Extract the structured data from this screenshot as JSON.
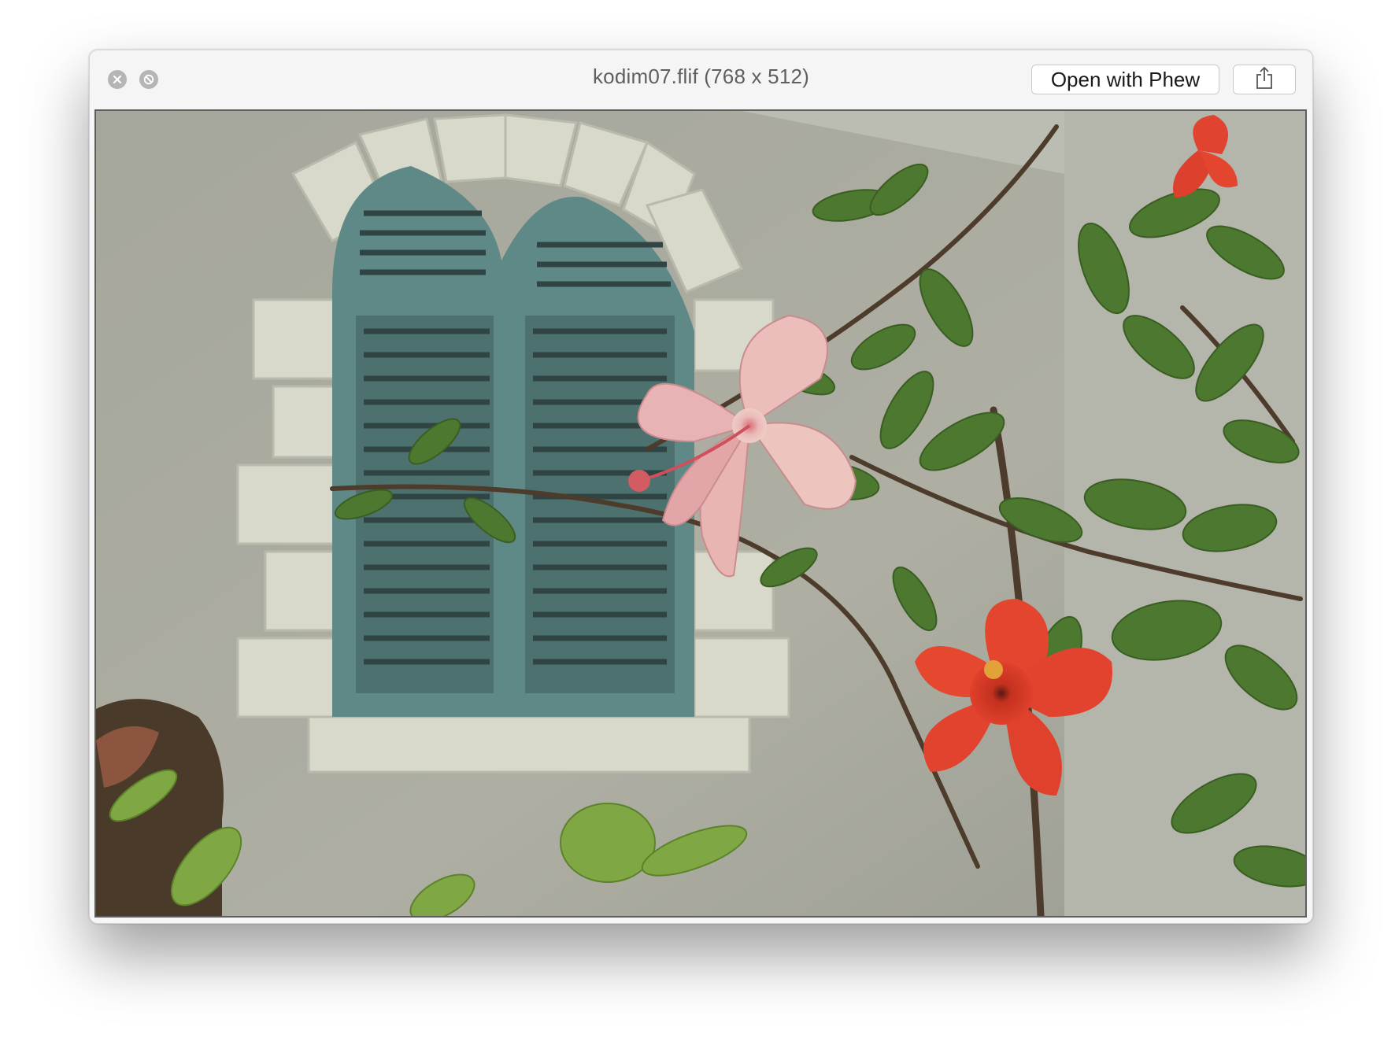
{
  "window": {
    "title": "kodim07.flif (768 x 512)"
  },
  "toolbar": {
    "open_with_label": "Open with Phew",
    "share_icon": "share-icon"
  },
  "traffic_lights": {
    "close_icon": "close-icon",
    "fullscreen_icon": "fullscreen-icon"
  },
  "preview": {
    "subject": "house-window-with-hibiscus-flowers",
    "colors": {
      "wall": "#a9aa9f",
      "shutter": "#5f8a87",
      "stone_trim": "#d9dacb",
      "pink_flower": "#e9b8b8",
      "red_flower": "#e2432f",
      "leaf": "#4f7a2f"
    }
  }
}
